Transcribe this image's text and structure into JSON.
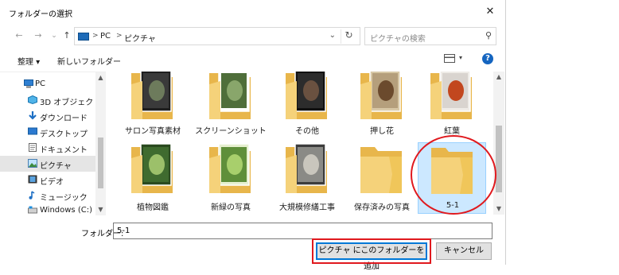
{
  "window": {
    "title": "フォルダーの選択",
    "close_symbol": "✕"
  },
  "nav": {
    "back_symbol": "←",
    "forward_symbol": "→",
    "recent_symbol": "⌄",
    "up_symbol": "↑"
  },
  "address": {
    "segments": [
      "PC",
      "ピクチャ"
    ],
    "separator": ">",
    "dropdown_symbol": "⌄",
    "refresh_symbol": "↻"
  },
  "search": {
    "placeholder": "ピクチャの検索",
    "icon_symbol": "⚲"
  },
  "toolbar": {
    "organize_label": "整理 ▾",
    "new_folder_label": "新しいフォルダー",
    "view_dropdown_symbol": "▾",
    "help_symbol": "?"
  },
  "sidebar": {
    "items": [
      {
        "label": "PC",
        "icon": "pc-icon"
      },
      {
        "label": "3D オブジェクト",
        "icon": "3d-objects-icon"
      },
      {
        "label": "ダウンロード",
        "icon": "download-icon"
      },
      {
        "label": "デスクトップ",
        "icon": "desktop-icon"
      },
      {
        "label": "ドキュメント",
        "icon": "documents-icon"
      },
      {
        "label": "ピクチャ",
        "icon": "pictures-icon",
        "selected": true
      },
      {
        "label": "ビデオ",
        "icon": "video-icon"
      },
      {
        "label": "ミュージック",
        "icon": "music-icon"
      },
      {
        "label": "Windows (C:)",
        "icon": "drive-icon"
      }
    ]
  },
  "folders": [
    {
      "name": "サロン写真素材",
      "thumb_colors": [
        "#3a3a3a",
        "#6d7b5c",
        "#1f1f1f"
      ]
    },
    {
      "name": "スクリーンショット",
      "thumb_colors": [
        "#4f6e3a",
        "#89a66b",
        "#ffffff"
      ]
    },
    {
      "name": "その他",
      "thumb_colors": [
        "#2c2c2c",
        "#6a5140",
        "#111111"
      ]
    },
    {
      "name": "押し花",
      "thumb_colors": [
        "#b59f7c",
        "#6b4a2d",
        "#d8c8a6"
      ]
    },
    {
      "name": "紅葉",
      "thumb_colors": [
        "#d9d4cf",
        "#c2471e",
        "#efece7"
      ]
    },
    {
      "name": "植物図鑑",
      "thumb_colors": [
        "#3f6b2f",
        "#9cc06a",
        "#2a4a1f"
      ]
    },
    {
      "name": "新緑の写真",
      "thumb_colors": [
        "#5f8f3a",
        "#a8cf6c",
        "#e6f0d0"
      ]
    },
    {
      "name": "大規模修繕工事",
      "thumb_colors": [
        "#8a8a86",
        "#c9c6bd",
        "#3c3c3c"
      ]
    },
    {
      "name": "保存済みの写真",
      "thumb_colors": []
    },
    {
      "name": "5-1",
      "thumb_colors": [],
      "selected": true
    }
  ],
  "folder_field": {
    "label": "フォルダー:",
    "value": "5-1"
  },
  "buttons": {
    "add_label": "ピクチャ にこのフォルダーを追加",
    "cancel_label": "キャンセル"
  },
  "colors": {
    "selection_bg": "#cce8ff",
    "accent": "#0078d7",
    "annotation": "#e0191e",
    "folder": "#f5d27a"
  }
}
